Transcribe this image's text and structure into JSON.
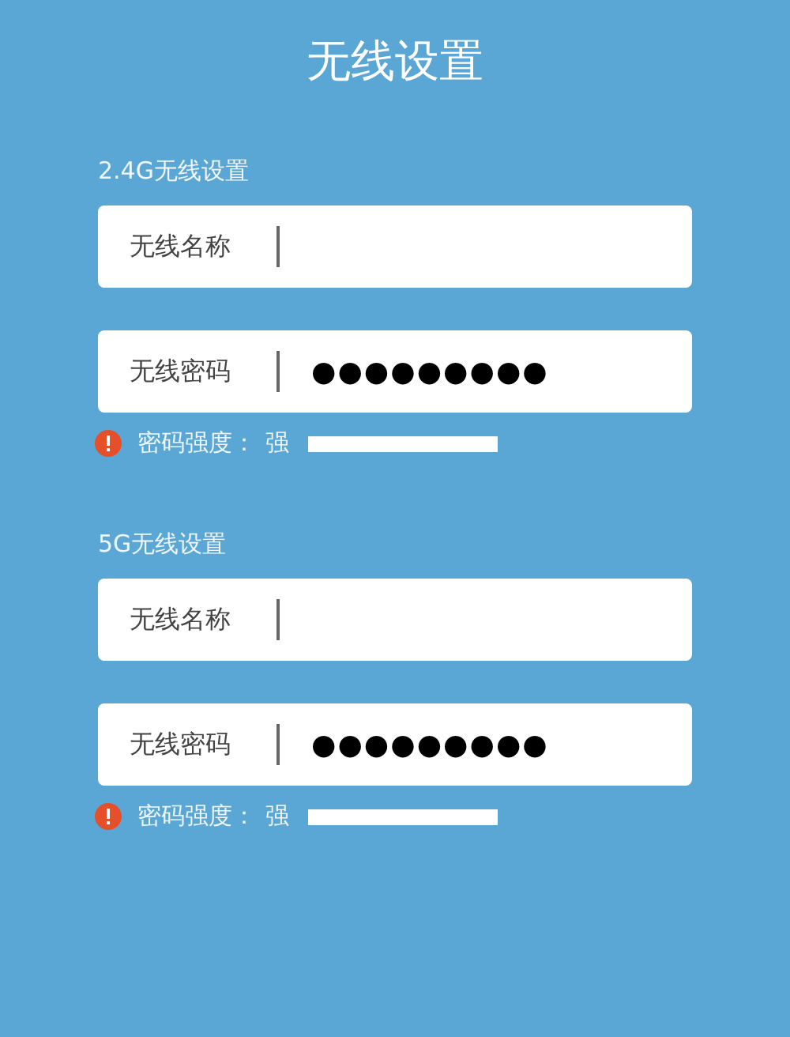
{
  "title": "无线设置",
  "sections": [
    {
      "heading": "2.4G无线设置",
      "fields": [
        {
          "label": "无线名称",
          "kind": "text"
        },
        {
          "label": "无线密码",
          "kind": "password",
          "value": "●●●●●●●●●"
        }
      ],
      "strength": {
        "label": "密码强度：",
        "value": "强",
        "level": 1
      }
    },
    {
      "heading": "5G无线设置",
      "fields": [
        {
          "label": "无线名称",
          "kind": "text"
        },
        {
          "label": "无线密码",
          "kind": "password",
          "value": "●●●●●●●●●"
        }
      ],
      "strength": {
        "label": "密码强度：",
        "value": "强",
        "level": 1
      }
    }
  ]
}
